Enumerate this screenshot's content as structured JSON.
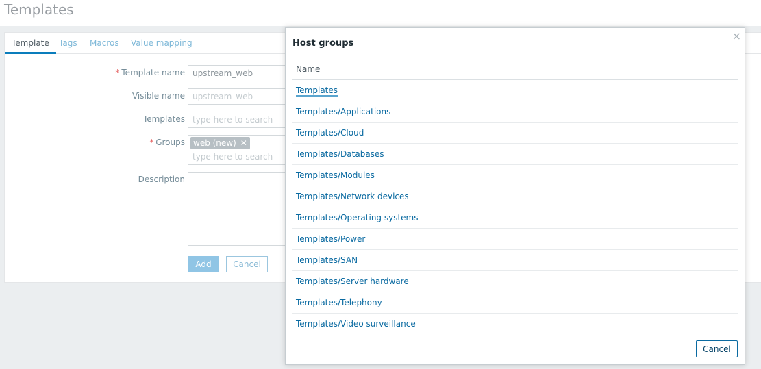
{
  "page": {
    "title": "Templates"
  },
  "form": {
    "tabs": [
      "Template",
      "Tags",
      "Macros",
      "Value mapping"
    ],
    "fields": {
      "template_name": {
        "label": "Template name",
        "required_mark": "*",
        "value": "upstream_web"
      },
      "visible_name": {
        "label": "Visible name",
        "placeholder": "upstream_web"
      },
      "templates": {
        "label": "Templates",
        "placeholder": "type here to search"
      },
      "groups": {
        "label": "Groups",
        "required_mark": "*",
        "chip": "web (new)",
        "chip_remove": "✕",
        "placeholder": "type here to search"
      },
      "description": {
        "label": "Description"
      }
    },
    "buttons": {
      "add": "Add",
      "cancel": "Cancel"
    }
  },
  "dialog": {
    "title": "Host groups",
    "close_glyph": "×",
    "column_header": "Name",
    "groups": [
      "Templates",
      "Templates/Applications",
      "Templates/Cloud",
      "Templates/Databases",
      "Templates/Modules",
      "Templates/Network devices",
      "Templates/Operating systems",
      "Templates/Power",
      "Templates/SAN",
      "Templates/Server hardware",
      "Templates/Telephony",
      "Templates/Video surveillance"
    ],
    "cancel_label": "Cancel"
  }
}
